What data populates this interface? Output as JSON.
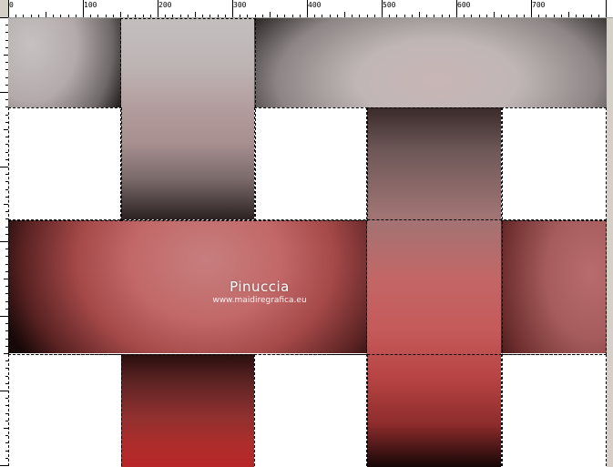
{
  "ruler": {
    "labels": [
      "0",
      "100",
      "200",
      "300",
      "400",
      "500",
      "600",
      "700"
    ]
  },
  "watermark": {
    "name": "Pinuccia",
    "url": "www.maidiregrafica.eu"
  },
  "colors": {
    "background": "#ffffff",
    "grey_band_light": "#c2bcbc",
    "rose_band": "#c47878",
    "red_band": "#b8282a",
    "dark_edge": "#1a1010"
  }
}
